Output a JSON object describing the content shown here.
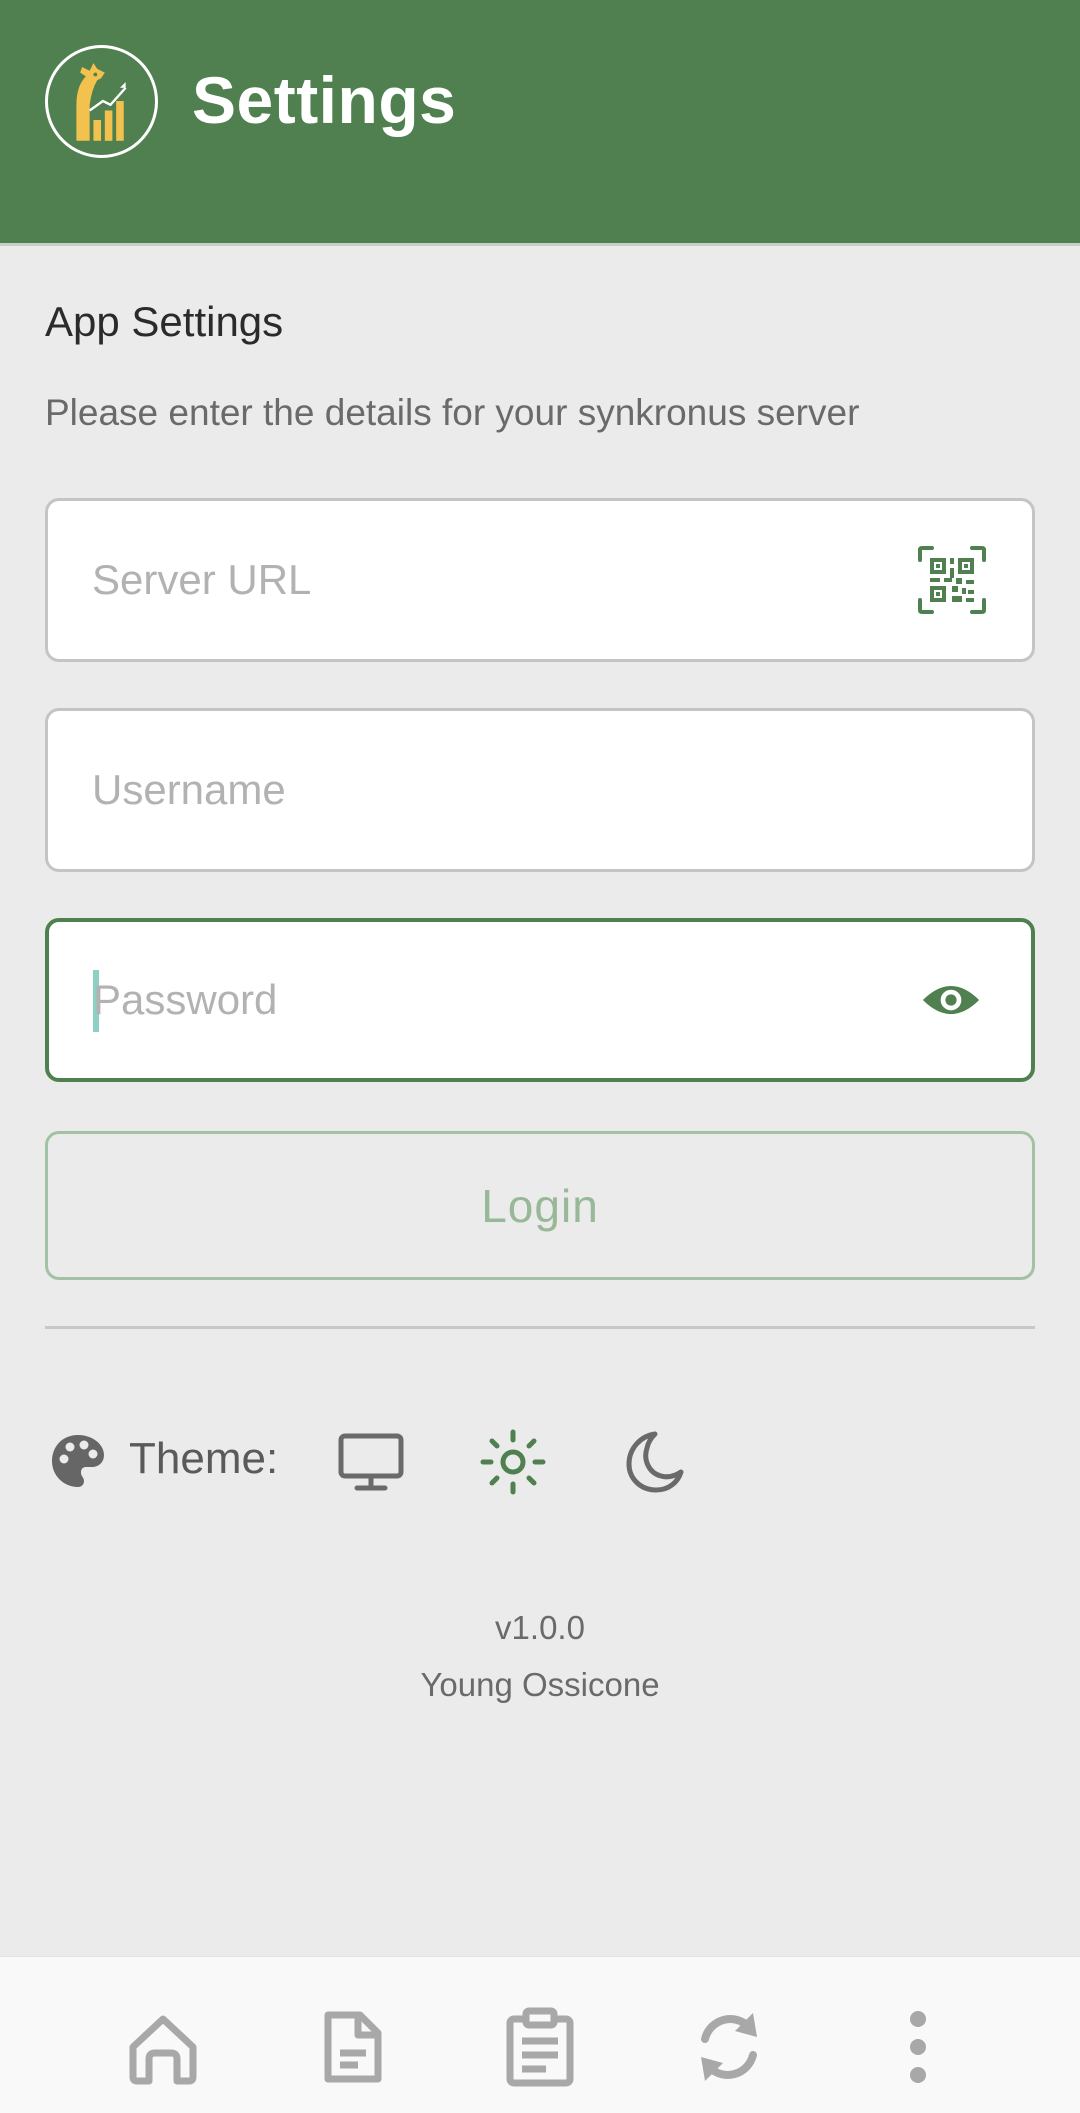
{
  "header": {
    "title": "Settings",
    "logo_icon": "giraffe-chart-logo-icon"
  },
  "settings": {
    "section_title": "App Settings",
    "subtitle": "Please enter the details for your synkronus server"
  },
  "form": {
    "server_url": {
      "placeholder": "Server URL",
      "value": "",
      "icon": "qr-code-icon"
    },
    "username": {
      "placeholder": "Username",
      "value": ""
    },
    "password": {
      "placeholder": "Password",
      "value": "",
      "icon": "eye-icon"
    },
    "login_label": "Login"
  },
  "theme": {
    "label": "Theme:",
    "icon": "palette-icon",
    "options": [
      {
        "name": "system",
        "icon": "monitor-icon",
        "selected": false
      },
      {
        "name": "light",
        "icon": "sun-icon",
        "selected": true
      },
      {
        "name": "dark",
        "icon": "moon-icon",
        "selected": false
      }
    ]
  },
  "footer": {
    "version": "v1.0.0",
    "release_name": "Young Ossicone"
  },
  "bottom_nav": {
    "items": [
      {
        "icon": "home-icon"
      },
      {
        "icon": "document-icon"
      },
      {
        "icon": "clipboard-icon"
      },
      {
        "icon": "sync-icon"
      },
      {
        "icon": "more-vertical-icon"
      }
    ]
  },
  "colors": {
    "primary": "#508050",
    "background": "#ebebeb",
    "logo_accent": "#f2c14e",
    "muted_text": "#6a6a6a",
    "icon_gray": "#a8a8a8"
  }
}
